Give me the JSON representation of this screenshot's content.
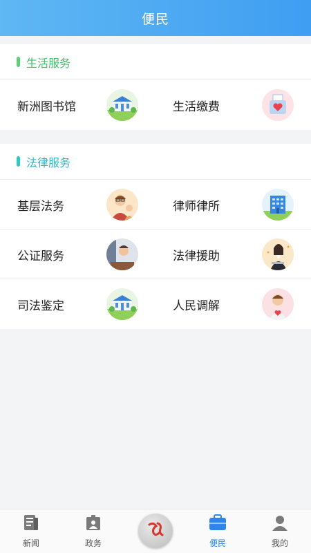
{
  "header": {
    "title": "便民"
  },
  "sections": [
    {
      "title": "生活服务",
      "accent": "#5fcf7a",
      "items": [
        {
          "label": "新洲图书馆",
          "icon": "library-building-icon"
        },
        {
          "label": "生活缴费",
          "icon": "payment-box-heart-icon"
        }
      ]
    },
    {
      "title": "法律服务",
      "accent": "#33c9c3",
      "items": [
        {
          "label": "基层法务",
          "icon": "grassroots-lawyer-icon"
        },
        {
          "label": "律师律所",
          "icon": "law-firm-building-icon"
        },
        {
          "label": "公证服务",
          "icon": "notary-officer-icon"
        },
        {
          "label": "法律援助",
          "icon": "legal-aid-lawyer-icon"
        },
        {
          "label": "司法鉴定",
          "icon": "judicial-building-icon"
        },
        {
          "label": "人民调解",
          "icon": "mediator-person-icon"
        }
      ]
    }
  ],
  "tabbar": {
    "tabs": [
      {
        "label": "新闻",
        "icon": "newspaper-icon",
        "active": false
      },
      {
        "label": "政务",
        "icon": "badge-icon",
        "active": false
      },
      {
        "label": "便民",
        "icon": "briefcase-icon",
        "active": true
      },
      {
        "label": "我的",
        "icon": "user-icon",
        "active": false
      }
    ],
    "center_icon": "logo-icon",
    "active_color": "#2d86e8",
    "inactive_color": "#555555"
  }
}
